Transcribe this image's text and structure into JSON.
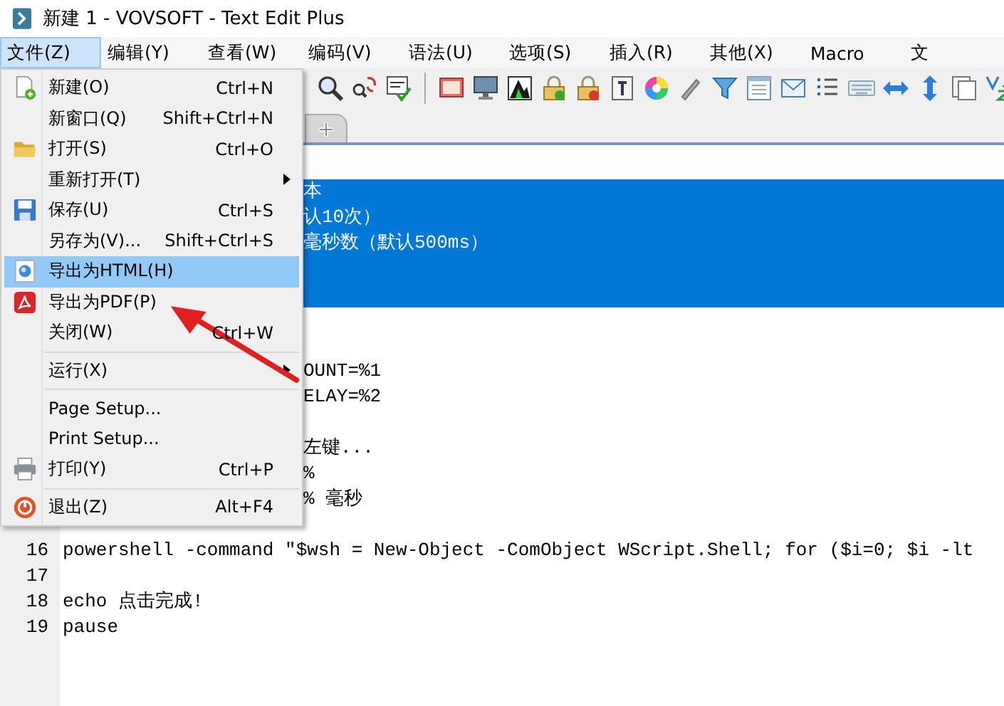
{
  "window": {
    "title": "新建 1 - VOVSOFT - Text Edit Plus"
  },
  "menu_bar": [
    {
      "label": "文件(Z)",
      "selected": true
    },
    {
      "label": "编辑(Y)",
      "selected": false
    },
    {
      "label": "查看(W)",
      "selected": false
    },
    {
      "label": "编码(V)",
      "selected": false
    },
    {
      "label": "语法(U)",
      "selected": false
    },
    {
      "label": "选项(S)",
      "selected": false
    },
    {
      "label": "插入(R)",
      "selected": false
    },
    {
      "label": "其他(X)",
      "selected": false
    },
    {
      "label": "Macro",
      "selected": false
    },
    {
      "label": "文",
      "selected": false
    }
  ],
  "file_menu": {
    "items": [
      {
        "kind": "item",
        "label": "新建(O)",
        "shortcut": "Ctrl+N",
        "submenu": false,
        "selected": false
      },
      {
        "kind": "item",
        "label": "新窗口(Q)",
        "shortcut": "Shift+Ctrl+N",
        "submenu": false,
        "selected": false
      },
      {
        "kind": "item",
        "label": "打开(S)",
        "shortcut": "Ctrl+O",
        "submenu": false,
        "selected": false
      },
      {
        "kind": "item",
        "label": "重新打开(T)",
        "submenu": true,
        "selected": false
      },
      {
        "kind": "item",
        "label": "保存(U)",
        "shortcut": "Ctrl+S",
        "submenu": false,
        "selected": false
      },
      {
        "kind": "item",
        "label": "另存为(V)...",
        "shortcut": "Shift+Ctrl+S",
        "submenu": false,
        "selected": false
      },
      {
        "kind": "item",
        "label": "导出为HTML(H)",
        "submenu": false,
        "selected": true
      },
      {
        "kind": "item",
        "label": "导出为PDF(P)",
        "submenu": false,
        "selected": false
      },
      {
        "kind": "item",
        "label": "关闭(W)",
        "shortcut": "Ctrl+W",
        "submenu": false,
        "selected": false
      },
      {
        "kind": "separator"
      },
      {
        "kind": "item",
        "label": "运行(X)",
        "submenu": true,
        "selected": false
      },
      {
        "kind": "separator"
      },
      {
        "kind": "item",
        "label": "Page Setup...",
        "submenu": false,
        "selected": false
      },
      {
        "kind": "item",
        "label": "Print Setup...",
        "submenu": false,
        "selected": false
      },
      {
        "kind": "item",
        "label": "打印(Y)",
        "shortcut": "Ctrl+P",
        "submenu": false,
        "selected": false
      },
      {
        "kind": "separator"
      },
      {
        "kind": "item",
        "label": "退出(Z)",
        "shortcut": "Alt+F4",
        "submenu": false,
        "selected": false
      }
    ]
  },
  "editor": {
    "lines": [
      {
        "selected": false
      },
      {
        "text": "本",
        "selected": true
      },
      {
        "text": "认10次）",
        "selected": true
      },
      {
        "text": "毫秒数（默认500ms）",
        "selected": true
      },
      {
        "selected": true
      },
      {
        "selected": true
      },
      {
        "selected": false
      },
      {
        "selected": false
      },
      {
        "text": "OUNT=%1",
        "selected": false
      },
      {
        "text": "ELAY=%2",
        "selected": false
      },
      {
        "selected": false
      },
      {
        "text": "左键...",
        "selected": false
      },
      {
        "text": "%",
        "selected": false
      },
      {
        "text": "% 毫秒",
        "selected": false
      },
      {
        "selected": false
      },
      {
        "number": "16",
        "text": "powershell -command \"$wsh = New-Object -ComObject WScript.Shell; for ($i=0; $i -lt",
        "selected": false
      },
      {
        "number": "17",
        "selected": false
      },
      {
        "number": "18",
        "text": "echo 点击完成!",
        "selected": false
      },
      {
        "number": "19",
        "text": "pause",
        "selected": false
      }
    ]
  }
}
